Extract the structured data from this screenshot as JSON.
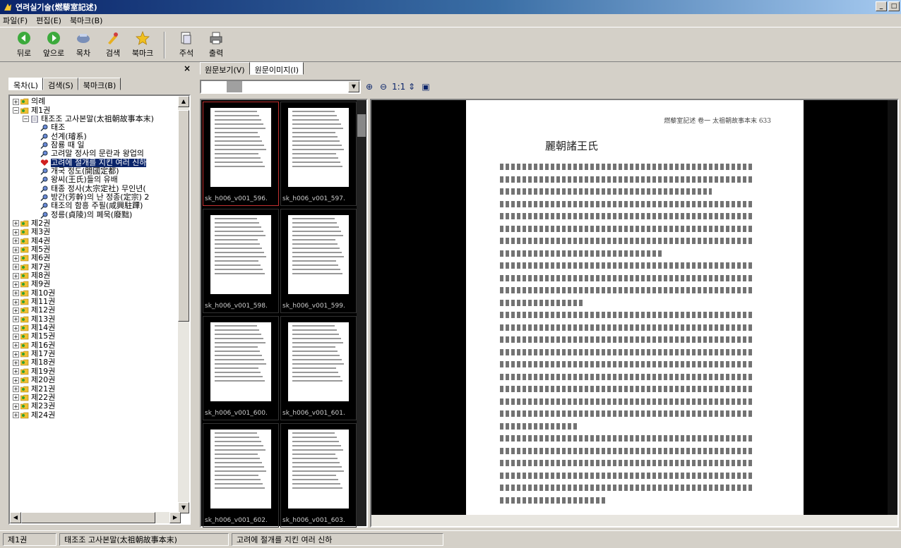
{
  "window": {
    "title": "연려실기술(燃藜室記述)",
    "controls": [
      "_",
      "□"
    ]
  },
  "menu": [
    "파일(F)",
    "편집(E)",
    "북마크(B)"
  ],
  "toolbar": {
    "buttons": [
      {
        "label": "뒤로",
        "icon": "back-icon"
      },
      {
        "label": "앞으로",
        "icon": "forward-icon"
      },
      {
        "label": "목차",
        "icon": "toc-icon"
      },
      {
        "label": "검색",
        "icon": "search-icon"
      },
      {
        "label": "북마크",
        "icon": "star-icon"
      },
      {
        "label": "주석",
        "icon": "note-icon"
      },
      {
        "label": "출력",
        "icon": "print-icon"
      }
    ]
  },
  "left_panel": {
    "close": "×",
    "tabs": [
      "목차(L)",
      "검색(S)",
      "북마크(B)"
    ],
    "tree": [
      {
        "level": 0,
        "exp": "+",
        "icon": "folder",
        "text": "의례"
      },
      {
        "level": 0,
        "exp": "−",
        "icon": "folder",
        "text": "제1권"
      },
      {
        "level": 1,
        "exp": "−",
        "icon": "doc",
        "text": "태조조 고사본말(太祖朝故事本末)"
      },
      {
        "level": 2,
        "icon": "leaf",
        "text": "태조"
      },
      {
        "level": 2,
        "icon": "leaf",
        "text": "선계(璿系)"
      },
      {
        "level": 2,
        "icon": "leaf",
        "text": "잠룡 때 일"
      },
      {
        "level": 2,
        "icon": "leaf",
        "text": "고려말 정사의 문란과 왕업의"
      },
      {
        "level": 2,
        "icon": "heart",
        "text": "고려에 절개를 지킨 여러 신하",
        "selected": true
      },
      {
        "level": 2,
        "icon": "leaf",
        "text": "개국 정도(開國定都)"
      },
      {
        "level": 2,
        "icon": "leaf",
        "text": "왕씨(王氏)들의 유배"
      },
      {
        "level": 2,
        "icon": "leaf",
        "text": "태종 정사(太宗定社) 무인년("
      },
      {
        "level": 2,
        "icon": "leaf",
        "text": "방간(芳幹)의 난 정종(定宗) 2"
      },
      {
        "level": 2,
        "icon": "leaf",
        "text": "태조의 함흥 주필(咸興駐蹕)"
      },
      {
        "level": 2,
        "icon": "leaf",
        "text": "정릉(貞陵)의 폐묵(廢黜)"
      },
      {
        "level": 0,
        "exp": "+",
        "icon": "folder",
        "text": "제2권"
      },
      {
        "level": 0,
        "exp": "+",
        "icon": "folder",
        "text": "제3권"
      },
      {
        "level": 0,
        "exp": "+",
        "icon": "folder",
        "text": "제4권"
      },
      {
        "level": 0,
        "exp": "+",
        "icon": "folder",
        "text": "제5권"
      },
      {
        "level": 0,
        "exp": "+",
        "icon": "folder",
        "text": "제6권"
      },
      {
        "level": 0,
        "exp": "+",
        "icon": "folder",
        "text": "제7권"
      },
      {
        "level": 0,
        "exp": "+",
        "icon": "folder",
        "text": "제8권"
      },
      {
        "level": 0,
        "exp": "+",
        "icon": "folder",
        "text": "제9권"
      },
      {
        "level": 0,
        "exp": "+",
        "icon": "folder",
        "text": "제10권"
      },
      {
        "level": 0,
        "exp": "+",
        "icon": "folder",
        "text": "제11권"
      },
      {
        "level": 0,
        "exp": "+",
        "icon": "folder",
        "text": "제12권"
      },
      {
        "level": 0,
        "exp": "+",
        "icon": "folder",
        "text": "제13권"
      },
      {
        "level": 0,
        "exp": "+",
        "icon": "folder",
        "text": "제14권"
      },
      {
        "level": 0,
        "exp": "+",
        "icon": "folder",
        "text": "제15권"
      },
      {
        "level": 0,
        "exp": "+",
        "icon": "folder",
        "text": "제16권"
      },
      {
        "level": 0,
        "exp": "+",
        "icon": "folder",
        "text": "제17권"
      },
      {
        "level": 0,
        "exp": "+",
        "icon": "folder",
        "text": "제18권"
      },
      {
        "level": 0,
        "exp": "+",
        "icon": "folder",
        "text": "제19권"
      },
      {
        "level": 0,
        "exp": "+",
        "icon": "folder",
        "text": "제20권"
      },
      {
        "level": 0,
        "exp": "+",
        "icon": "folder",
        "text": "제21권"
      },
      {
        "level": 0,
        "exp": "+",
        "icon": "folder",
        "text": "제22권"
      },
      {
        "level": 0,
        "exp": "+",
        "icon": "folder",
        "text": "제23권"
      },
      {
        "level": 0,
        "exp": "+",
        "icon": "folder",
        "text": "제24권"
      }
    ]
  },
  "right_tabs": [
    "원문보기(V)",
    "원문이미지(I)"
  ],
  "viewer_tools": [
    "zoom-in-icon",
    "zoom-out-icon",
    "1:1",
    "fit-icon",
    "save-icon"
  ],
  "thumbnails": [
    "sk_h006_v001_596.",
    "sk_h006_v001_597.",
    "sk_h006_v001_598.",
    "sk_h006_v001_599.",
    "sk_h006_v001_600.",
    "sk_h006_v001_601.",
    "sk_h006_v001_602.",
    "sk_h006_v001_603."
  ],
  "document_page": {
    "header": "燃藜室記述 卷一 太祖朝故事本末  633",
    "title": "麗朝諸王氏"
  },
  "status": [
    "제1권",
    "태조조 고사본말(太祖朝故事本末)",
    "고려에 절개를 지킨 여러 신하"
  ],
  "colors": {
    "title_gradient_start": "#0a246a",
    "selection": "#0a246a",
    "chrome": "#d4d0c8",
    "viewer_bg": "#000000",
    "active_thumb_border": "#c03030"
  }
}
